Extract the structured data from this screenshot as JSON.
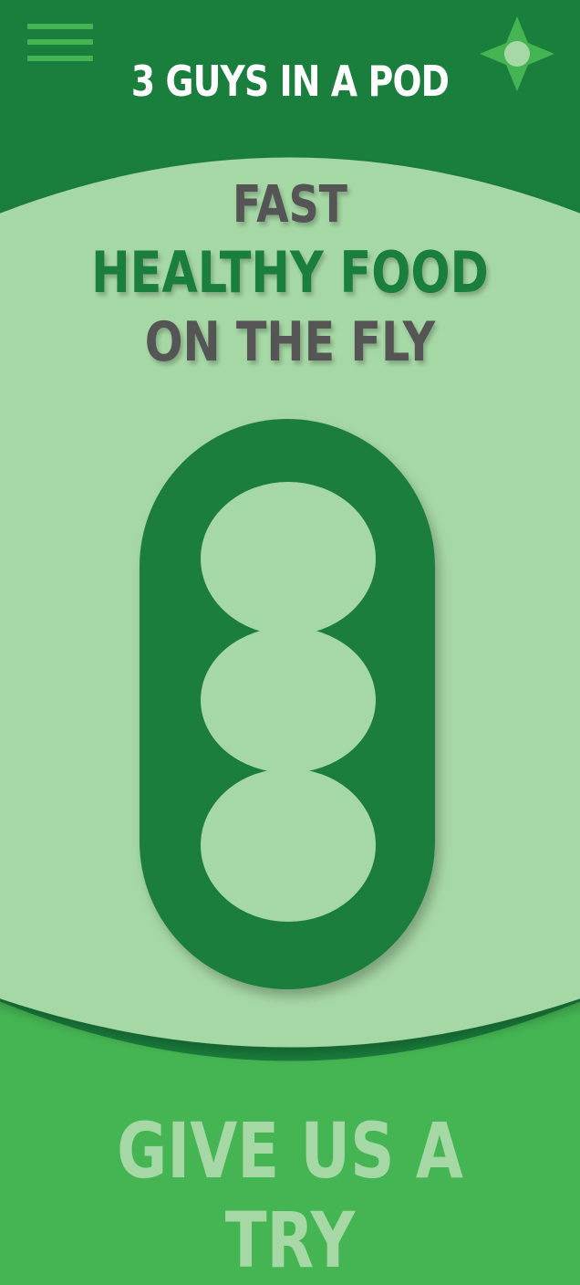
{
  "header": {
    "logo_text": "3 GUYS IN A POD",
    "menu_icon": "hamburger-menu-icon",
    "location_icon": "compass-location-icon"
  },
  "hero": {
    "line1": "FAST",
    "line2": "HEALTHY FOOD",
    "line3": "ON THE FLY",
    "graphic": "pea-pod-icon"
  },
  "cta": {
    "label": "GIVE US A TRY"
  },
  "colors": {
    "dark_green": "#1a7e3c",
    "light_green": "#a6d8a5",
    "bright_green": "#45b553",
    "gray_text": "#555555",
    "white": "#ffffff"
  }
}
